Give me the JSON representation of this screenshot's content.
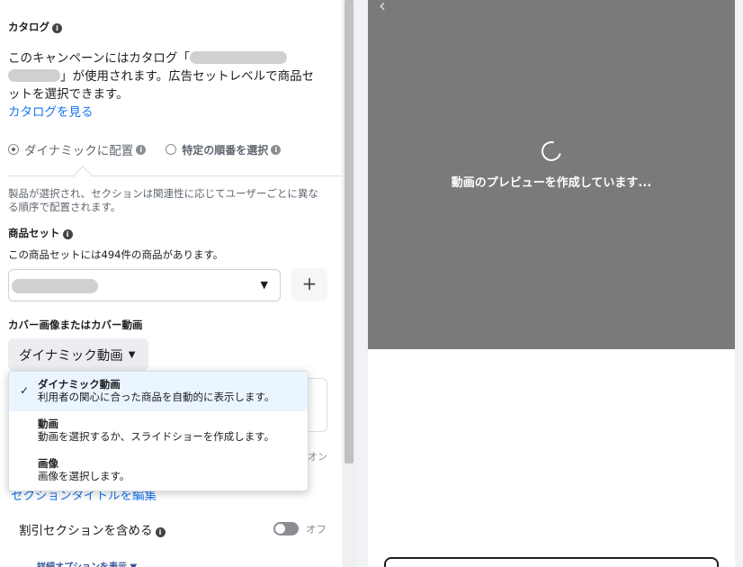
{
  "catalog": {
    "heading": "カタログ",
    "text_line1": "このキャンペーンにはカタログ「",
    "text_line2": "」が使用されます。広告セットレベルで商品セ",
    "text_line3": "ットを選択できます。",
    "view_link": "カタログを見る"
  },
  "placement": {
    "option_dynamic": "ダイナミックに配置",
    "option_specific": "特定の順番を選択",
    "selected": "ダイナミックに配置",
    "description": "製品が選択され、セクションは関連性に応じてユーザーごとに異なる順序で配置されます。"
  },
  "product_set": {
    "heading": "商品セット",
    "count_text": "この商品セットには494件の商品があります。",
    "add_label": "+"
  },
  "cover": {
    "heading": "カバー画像またはカバー動画",
    "button_label": "ダイナミック動画",
    "menu": [
      {
        "title": "ダイナミック動画",
        "subtitle": "利用者の関心に合った商品を自動的に表示します。",
        "selected": true
      },
      {
        "title": "動画",
        "subtitle": "動画を選択するか、スライドショーを作成します。",
        "selected": false
      },
      {
        "title": "画像",
        "subtitle": "画像を選択します。",
        "selected": false
      }
    ]
  },
  "hidden": {
    "on_label": "オン",
    "edit_section_title": "セクションタイトルを編集"
  },
  "discount": {
    "label": "割引セクションを含める",
    "toggle_state": "オフ"
  },
  "advanced_link": "詳細オプションを表示 ▼",
  "preview": {
    "loading_text": "動画のプレビューを作成しています..."
  },
  "icons": {
    "info": "info-icon",
    "check": "check-icon",
    "dropdown": "caret-down-icon",
    "back": "chevron-left-icon",
    "spinner": "loading-spinner-icon"
  }
}
